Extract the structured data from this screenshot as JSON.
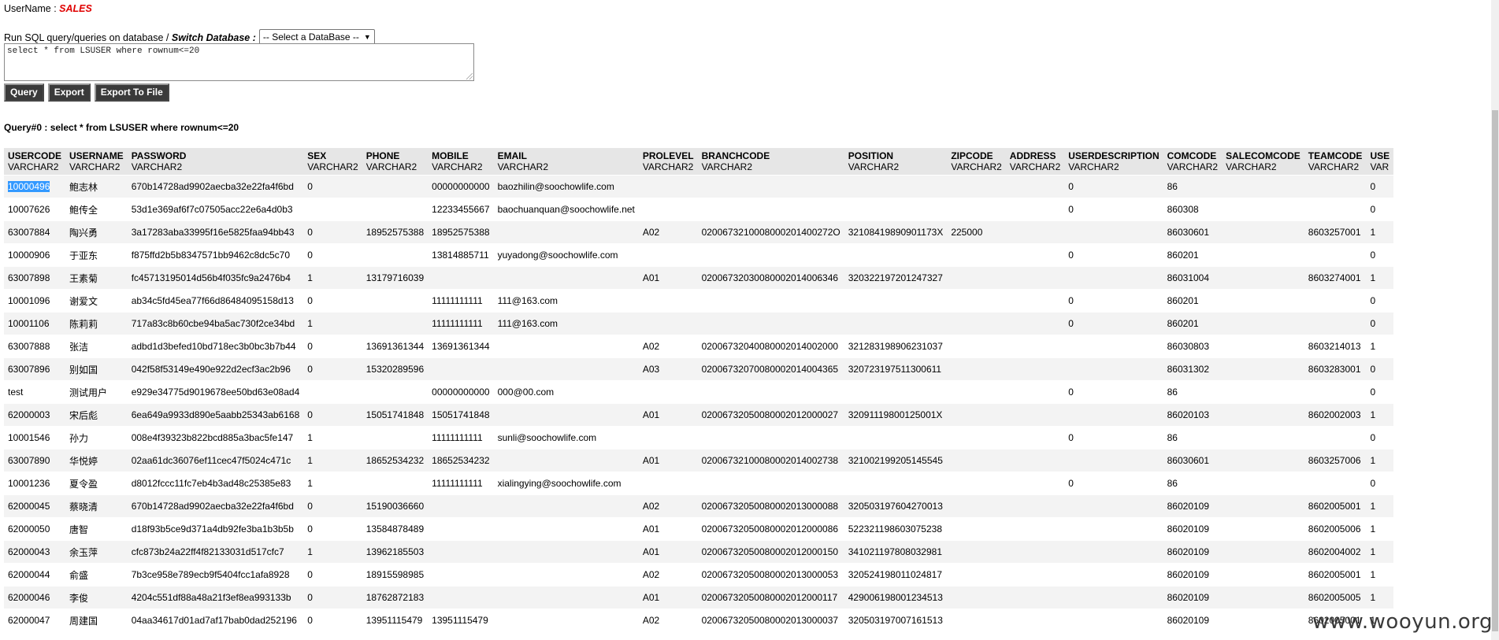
{
  "user": {
    "label": "UserName :",
    "name": "SALES"
  },
  "run": {
    "label": "Run SQL query/queries on database /",
    "switch_label": "Switch Database :",
    "select_value": "-- Select a DataBase --"
  },
  "sql_text": "select * from LSUSER where rownum<=20",
  "buttons": {
    "query": "Query",
    "export": "Export",
    "export_file": "Export To File"
  },
  "query_title": "Query#0 : select * from LSUSER where rownum<=20",
  "columns": [
    {
      "name": "USERCODE",
      "type": "VARCHAR2"
    },
    {
      "name": "USERNAME",
      "type": "VARCHAR2"
    },
    {
      "name": "PASSWORD",
      "type": "VARCHAR2"
    },
    {
      "name": "SEX",
      "type": "VARCHAR2"
    },
    {
      "name": "PHONE",
      "type": "VARCHAR2"
    },
    {
      "name": "MOBILE",
      "type": "VARCHAR2"
    },
    {
      "name": "EMAIL",
      "type": "VARCHAR2"
    },
    {
      "name": "PROLEVEL",
      "type": "VARCHAR2"
    },
    {
      "name": "BRANCHCODE",
      "type": "VARCHAR2"
    },
    {
      "name": "POSITION",
      "type": "VARCHAR2"
    },
    {
      "name": "ZIPCODE",
      "type": "VARCHAR2"
    },
    {
      "name": "ADDRESS",
      "type": "VARCHAR2"
    },
    {
      "name": "USERDESCRIPTION",
      "type": "VARCHAR2"
    },
    {
      "name": "COMCODE",
      "type": "VARCHAR2"
    },
    {
      "name": "SALECOMCODE",
      "type": "VARCHAR2"
    },
    {
      "name": "TEAMCODE",
      "type": "VARCHAR2"
    },
    {
      "name": "USE",
      "type": "VAR"
    }
  ],
  "rows": [
    [
      "10000496",
      "鲍志林",
      "670b14728ad9902aecba32e22fa4f6bd",
      "0",
      "",
      "00000000000",
      "baozhilin@soochowlife.com",
      "",
      "",
      "",
      "",
      "",
      "0",
      "86",
      "",
      "",
      "0"
    ],
    [
      "10007626",
      "鲍传全",
      "53d1e369af6f7c07505acc22e6a4d0b3",
      "",
      "",
      "12233455667",
      "baochuanquan@soochowlife.net",
      "",
      "",
      "",
      "",
      "",
      "0",
      "860308",
      "",
      "",
      "0"
    ],
    [
      "63007884",
      "陶兴勇",
      "3a17283aba33995f16e5825faa94bb43",
      "0",
      "18952575388",
      "18952575388",
      "",
      "A02",
      "0200673210008000201400272O",
      "32108419890901173X",
      "225000",
      "",
      "",
      "86030601",
      "",
      "8603257001",
      "1"
    ],
    [
      "10000906",
      "于亚东",
      "f875ffd2b5b8347571bb9462c8dc5c70",
      "0",
      "",
      "13814885711",
      "yuyadong@soochowlife.com",
      "",
      "",
      "",
      "",
      "",
      "0",
      "860201",
      "",
      "",
      "0"
    ],
    [
      "63007898",
      "王素菊",
      "fc45713195014d56b4f035fc9a2476b4",
      "1",
      "13179716039",
      "",
      "",
      "A01",
      "02006732030080002014006346",
      "320322197201247327",
      "",
      "",
      "",
      "86031004",
      "",
      "8603274001",
      "1"
    ],
    [
      "10001096",
      "谢爱文",
      "ab34c5fd45ea77f66d86484095158d13",
      "0",
      "",
      "11111111111",
      "111@163.com",
      "",
      "",
      "",
      "",
      "",
      "0",
      "860201",
      "",
      "",
      "0"
    ],
    [
      "10001106",
      "陈莉莉",
      "717a83c8b60cbe94ba5ac730f2ce34bd",
      "1",
      "",
      "11111111111",
      "111@163.com",
      "",
      "",
      "",
      "",
      "",
      "0",
      "860201",
      "",
      "",
      "0"
    ],
    [
      "63007888",
      "张洁",
      "adbd1d3befed10bd718ec3b0bc3b7b44",
      "0",
      "13691361344",
      "13691361344",
      "",
      "A02",
      "02006732040080002014002000",
      "321283198906231037",
      "",
      "",
      "",
      "86030803",
      "",
      "8603214013",
      "1"
    ],
    [
      "63007896",
      "别如国",
      "042f58f53149e490e922d2ecf3ac2b96",
      "0",
      "15320289596",
      "",
      "",
      "A03",
      "02006732070080002014004365",
      "320723197511300611",
      "",
      "",
      "",
      "86031302",
      "",
      "8603283001",
      "0"
    ],
    [
      "test",
      "测试用户",
      "e929e34775d9019678ee50bd63e08ad4",
      "",
      "",
      "00000000000",
      "000@00.com",
      "",
      "",
      "",
      "",
      "",
      "0",
      "86",
      "",
      "",
      "0"
    ],
    [
      "62000003",
      "宋后彪",
      "6ea649a9933d890e5aabb25343ab6168",
      "0",
      "15051741848",
      "15051741848",
      "",
      "A01",
      "02006732050080002012000027",
      "32091119800125001X",
      "",
      "",
      "",
      "86020103",
      "",
      "8602002003",
      "1"
    ],
    [
      "10001546",
      "孙力",
      "008e4f39323b822bcd885a3bac5fe147",
      "1",
      "",
      "11111111111",
      "sunli@soochowlife.com",
      "",
      "",
      "",
      "",
      "",
      "0",
      "86",
      "",
      "",
      "0"
    ],
    [
      "63007890",
      "华悦婷",
      "02aa61dc36076ef11cec47f5024c471c",
      "1",
      "18652534232",
      "18652534232",
      "",
      "A01",
      "02006732100080002014002738",
      "321002199205145545",
      "",
      "",
      "",
      "86030601",
      "",
      "8603257006",
      "1"
    ],
    [
      "10001236",
      "夏令盈",
      "d8012fccc11fc7eb4b3ad48c25385e83",
      "1",
      "",
      "11111111111",
      "xialingying@soochowlife.com",
      "",
      "",
      "",
      "",
      "",
      "0",
      "86",
      "",
      "",
      "0"
    ],
    [
      "62000045",
      "蔡晓清",
      "670b14728ad9902aecba32e22fa4f6bd",
      "0",
      "15190036660",
      "",
      "",
      "A02",
      "02006732050080002013000088",
      "320503197604270013",
      "",
      "",
      "",
      "86020109",
      "",
      "8602005001",
      "1"
    ],
    [
      "62000050",
      "唐智",
      "d18f93b5ce9d371a4db92fe3ba1b3b5b",
      "0",
      "13584878489",
      "",
      "",
      "A01",
      "02006732050080002012000086",
      "522321198603075238",
      "",
      "",
      "",
      "86020109",
      "",
      "8602005006",
      "1"
    ],
    [
      "62000043",
      "余玉萍",
      "cfc873b24a22ff4f82133031d517cfc7",
      "1",
      "13962185503",
      "",
      "",
      "A01",
      "02006732050080002012000150",
      "341021197808032981",
      "",
      "",
      "",
      "86020109",
      "",
      "8602004002",
      "1"
    ],
    [
      "62000044",
      "俞盛",
      "7b3ce958e789ecb9f5404fcc1afa8928",
      "0",
      "18915598985",
      "",
      "",
      "A02",
      "02006732050080002013000053",
      "320524198011024817",
      "",
      "",
      "",
      "86020109",
      "",
      "8602005001",
      "1"
    ],
    [
      "62000046",
      "李俊",
      "4204c551df88a48a21f3ef8ea993133b",
      "0",
      "18762872183",
      "",
      "",
      "A01",
      "02006732050080002012000117",
      "429006198001234513",
      "",
      "",
      "",
      "86020109",
      "",
      "8602005005",
      "1"
    ],
    [
      "62000047",
      "周建国",
      "04aa34617d01ad7af17bab0dad252196",
      "0",
      "13951115479",
      "13951115479",
      "",
      "A02",
      "02006732050080002013000037",
      "320503197007161513",
      "",
      "",
      "",
      "86020109",
      "",
      "8602005001",
      "1"
    ]
  ],
  "watermark": "www.wooyun.org"
}
